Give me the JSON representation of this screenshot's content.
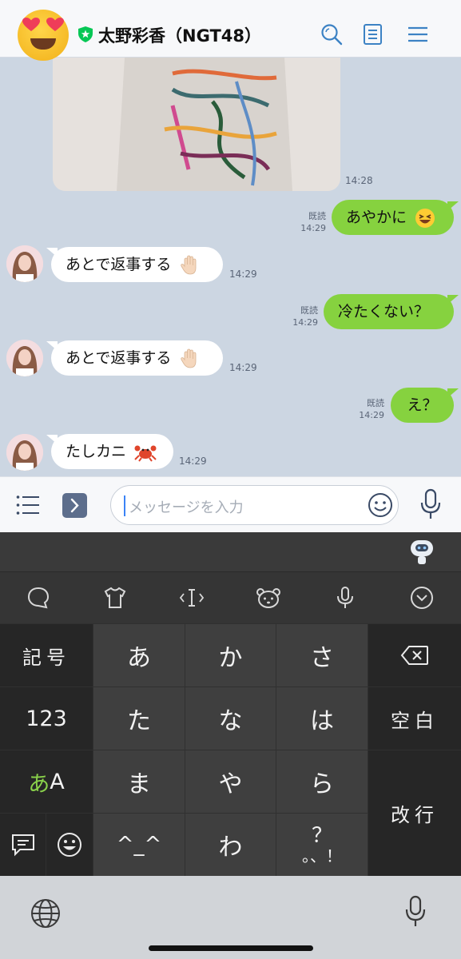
{
  "header": {
    "title": "太野彩香（NGT48）"
  },
  "messages": {
    "photo_time": "14:28",
    "m1": {
      "text": "あやかに",
      "read": "既読",
      "time": "14:29"
    },
    "m2": {
      "text": "あとで返事する",
      "time": "14:29"
    },
    "m3": {
      "text": "冷たくない？",
      "read": "既読",
      "time": "14:29"
    },
    "m4": {
      "text": "あとで返事する",
      "time": "14:29"
    },
    "m5": {
      "text": "え？",
      "read": "既読",
      "time": "14:29"
    },
    "m6": {
      "text": "たしカニ",
      "time": "14:29"
    }
  },
  "input": {
    "placeholder": "メッセージを入力"
  },
  "keyboard": {
    "row1": [
      "記号",
      "あ",
      "か",
      "さ"
    ],
    "row2": [
      "123",
      "た",
      "な",
      "は",
      "空白"
    ],
    "row3": [
      "あ",
      "A",
      "ま",
      "や",
      "ら",
      "改行"
    ],
    "row4": [
      "^_^",
      "わ",
      "？",
      "。、！"
    ]
  },
  "colors": {
    "chat_bg": "#ccd6e2",
    "out_bubble": "#86d23f",
    "in_bubble": "#ffffff",
    "accent": "#3c82c4",
    "official_green": "#06c755",
    "kana_green": "#8ad24b"
  },
  "icons": [
    "heart-eyes-emoji-icon",
    "official-badge-icon",
    "search-icon",
    "notes-icon",
    "menu-icon",
    "list-icon",
    "chevron-right-icon",
    "emoji-icon",
    "microphone-icon",
    "bot-icon",
    "chat-bubble-icon",
    "shirt-icon",
    "text-cursor-icon",
    "bear-icon",
    "chevron-down-icon",
    "backspace-icon",
    "globe-icon"
  ]
}
